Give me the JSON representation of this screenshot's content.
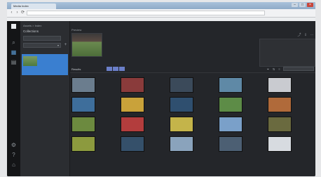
{
  "browser": {
    "tab_title": "Media Index",
    "url": "",
    "bookmark_text": ""
  },
  "rail": {
    "icons": [
      "app-logo",
      "search-icon",
      "folder-icon",
      "grid-icon",
      "settings-icon",
      "help-icon",
      "user-icon"
    ]
  },
  "panel": {
    "breadcrumb": "Assets > Index",
    "title": "Collections",
    "input_value": "",
    "select_value": "",
    "sub_label": "",
    "selected_item": {
      "label": "",
      "meta": ""
    }
  },
  "main": {
    "section_label": "Preview",
    "meta_rows": [
      {
        "key": "",
        "value": ""
      },
      {
        "key": "",
        "value": ""
      },
      {
        "key": "",
        "value": ""
      },
      {
        "key": "",
        "value": ""
      },
      {
        "key": "",
        "value": ""
      },
      {
        "key": "",
        "value": ""
      }
    ],
    "side_card_label": "",
    "strip_title": "Results",
    "segments": [
      "",
      "",
      ""
    ],
    "search_placeholder": "",
    "grid_header": ""
  },
  "grid": {
    "items": [
      {
        "title": "",
        "meta": "",
        "color": "#6b7d8e"
      },
      {
        "title": "",
        "meta": "",
        "color": "#8a3b3b"
      },
      {
        "title": "",
        "meta": "",
        "color": "#3b4a5a"
      },
      {
        "title": "",
        "meta": "",
        "color": "#5f89a6"
      },
      {
        "title": "",
        "meta": "",
        "color": "#c9cbd0"
      },
      {
        "title": "",
        "meta": "",
        "color": "#3e6e9b"
      },
      {
        "title": "",
        "meta": "",
        "color": "#c9a23a"
      },
      {
        "title": "",
        "meta": "",
        "color": "#2f4f6f"
      },
      {
        "title": "",
        "meta": "",
        "color": "#5d8c47"
      },
      {
        "title": "",
        "meta": "",
        "color": "#b06a3a"
      },
      {
        "title": "",
        "meta": "",
        "color": "#6c8a3f"
      },
      {
        "title": "",
        "meta": "",
        "color": "#b33d3d"
      },
      {
        "title": "",
        "meta": "",
        "color": "#c4b44a"
      },
      {
        "title": "",
        "meta": "",
        "color": "#7aa0c9"
      },
      {
        "title": "",
        "meta": "",
        "color": "#6a6a3f"
      },
      {
        "title": "",
        "meta": "",
        "color": "#8c9a3e"
      },
      {
        "title": "",
        "meta": "",
        "color": "#35506a"
      },
      {
        "title": "",
        "meta": "",
        "color": "#8aa3bc"
      },
      {
        "title": "",
        "meta": "",
        "color": "#4c5f73"
      },
      {
        "title": "",
        "meta": "",
        "color": "#d7dbe0"
      }
    ]
  }
}
